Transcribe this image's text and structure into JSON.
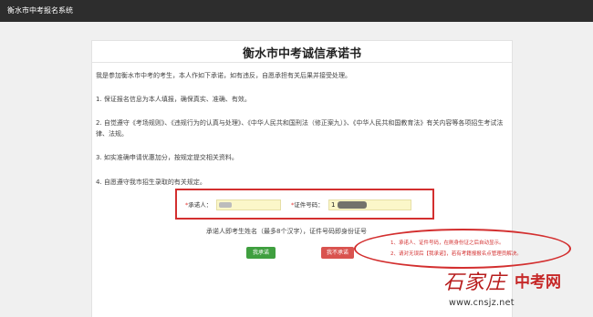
{
  "header": {
    "app_title": "衡水市中考报名系统"
  },
  "page": {
    "title": "衡水市中考诚信承诺书",
    "intro": "我是参加衡水市中考的考生，本人作如下承诺，如有违反，自愿承担有关后果并接受处理。",
    "items": [
      "1. 保证报名信息为本人填报，确保真实、准确、有效。",
      "2. 自觉遵守《考场规则》、《违规行为的认真与处理》、《中华人民共和国刑法（修正案九）》、《中华人民共和国教育法》有关内容等各项招生考试法律、法规。",
      "3. 如实准确申请优惠加分，按规定提交相关资料。",
      "4. 自愿遵守我市招生录取的有关规定。"
    ]
  },
  "form": {
    "required_mark": "*",
    "promisor_label": "承诺人：",
    "id_label": "证件号码：",
    "id_value_visible": "1",
    "note": "承诺人即考生姓名（最多8个汉字），证件号码即身份证号"
  },
  "buttons": {
    "agree": "我承诺",
    "disagree": "我不承诺"
  },
  "annotations": [
    "1、承诺人、证件号码，在刷身份证之后自动显示。",
    "2、请对无误后【我承诺】，若有考籍报报名点管理员解决。"
  ],
  "watermark": {
    "script": "石家庄",
    "logo": "中考网",
    "url": "www.cnsjz.net"
  },
  "colors": {
    "topbar": "#2d2d2d",
    "annotation_red": "#d32f2f",
    "agree_green": "#3f9f3f",
    "disagree_red": "#d9534f",
    "input_yellow": "#fbf7c9"
  }
}
